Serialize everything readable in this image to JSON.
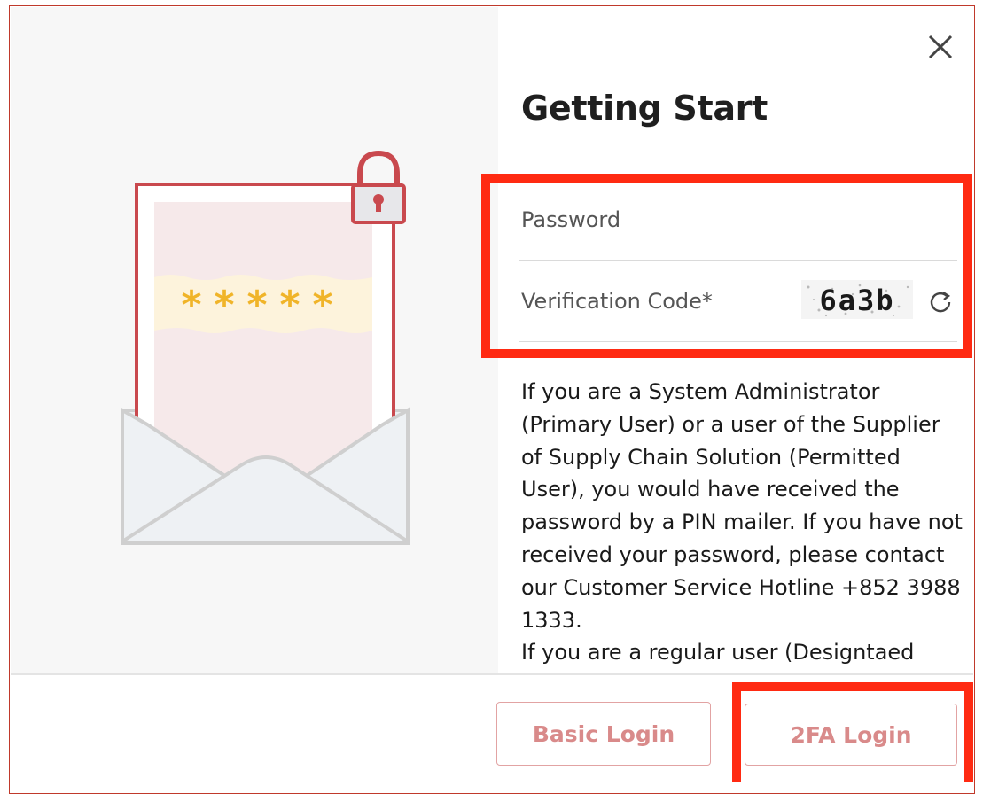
{
  "dialog": {
    "title": "Getting Start",
    "close_icon": "close-icon"
  },
  "illustration": {
    "masked_password": "*****",
    "icons": [
      "envelope-icon",
      "padlock-icon"
    ]
  },
  "form": {
    "password_label": "Password",
    "verification_label": "Verification Code*",
    "captcha_text": "6a3b",
    "refresh_icon": "refresh-icon"
  },
  "info": {
    "text": "If you are a System Administrator (Primary User) or a user of the Supplier of Supply Chain Solution (Permitted User), you would have received the password by a PIN mailer. If you have not received your password, please contact our Customer Service Hotline +852 3988 1333.\nIf you are a regular user (Designtaed"
  },
  "footer": {
    "basic_login_label": "Basic Login",
    "twofa_login_label": "2FA Login"
  },
  "colors": {
    "accent": "#c0392b",
    "highlight": "#ff2a12",
    "button_text": "#d98a8a",
    "button_border": "#e2a3a3",
    "star": "#f0b429",
    "left_panel": "#f7f7f7"
  }
}
